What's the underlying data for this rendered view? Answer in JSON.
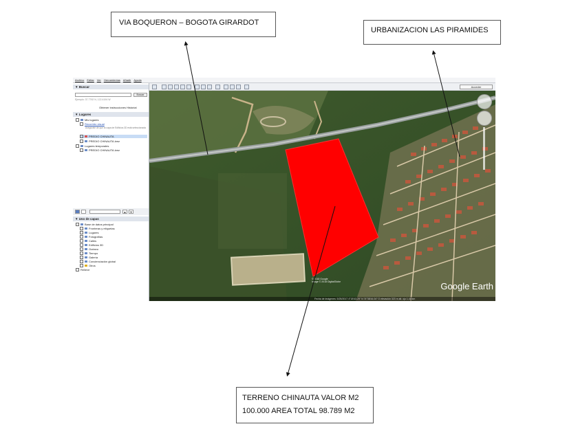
{
  "callouts": {
    "top_left": "VIA BOQUERON – BOGOTA GIRARDOT",
    "top_right": "URBANIZACION LAS PIRAMIDES",
    "bottom_line1": "TERRENO CHINAUTA VALOR M2",
    "bottom_line2": "100.000 AREA TOTAL 98.789 M2"
  },
  "google_earth": {
    "menu": [
      "Archivo",
      "Editar",
      "Ver",
      "Herramientas",
      "Añadir",
      "Ayuda"
    ],
    "access_button": "Acceder",
    "search_header": "▼ Buscar",
    "search_button": "Buscar",
    "search_hint": "Ejemplo: 37.7792 N, 122.4194 W",
    "search_links": "Obtener instrucciones  Historial",
    "places_header": "▼ Lugares",
    "places": [
      "Mis lugares",
      "Recorrido visual",
      "Asegúrate de que la capa de Edificios 3D está seleccionada",
      "PREDIO CHINAUTA",
      "PREDIO CHINAUTA.kmz",
      "Lugares temporales",
      "PREDIO CHINAUTA.kmz"
    ],
    "layers_header": "▼ Uso de capas",
    "layers": [
      "Base de datos principal",
      "Fronteras y etiquetas",
      "Lugares",
      "Fotografías",
      "Calles",
      "Edificios 3D",
      "Océano",
      "Tiempo",
      "Galería",
      "Concienciación global",
      "Otros",
      "Relieve"
    ],
    "logo": "Google Earth",
    "copyright": "© 2018 Google\nImage © 2018 DigitalGlobe",
    "status_bar": "Fecha de imágenes: 5/25/2017    4°18'43.25\" N    74°38'44.04\" O   elevación   323 m      alt. ojo   1.44 km",
    "polygon_color": "#ff0000"
  }
}
